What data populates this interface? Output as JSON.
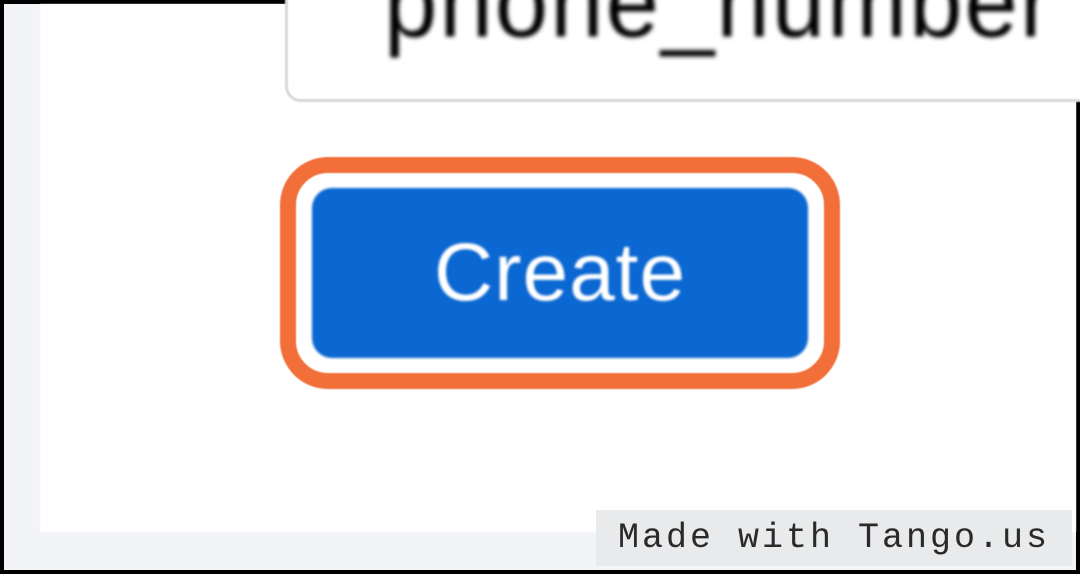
{
  "input": {
    "value": "phone_number"
  },
  "button": {
    "create_label": "Create"
  },
  "watermark": {
    "text": "Made with Tango.us"
  },
  "colors": {
    "highlight": "#f26f3a",
    "primary": "#0b67d1",
    "panel_bg": "#f2f4f7"
  }
}
